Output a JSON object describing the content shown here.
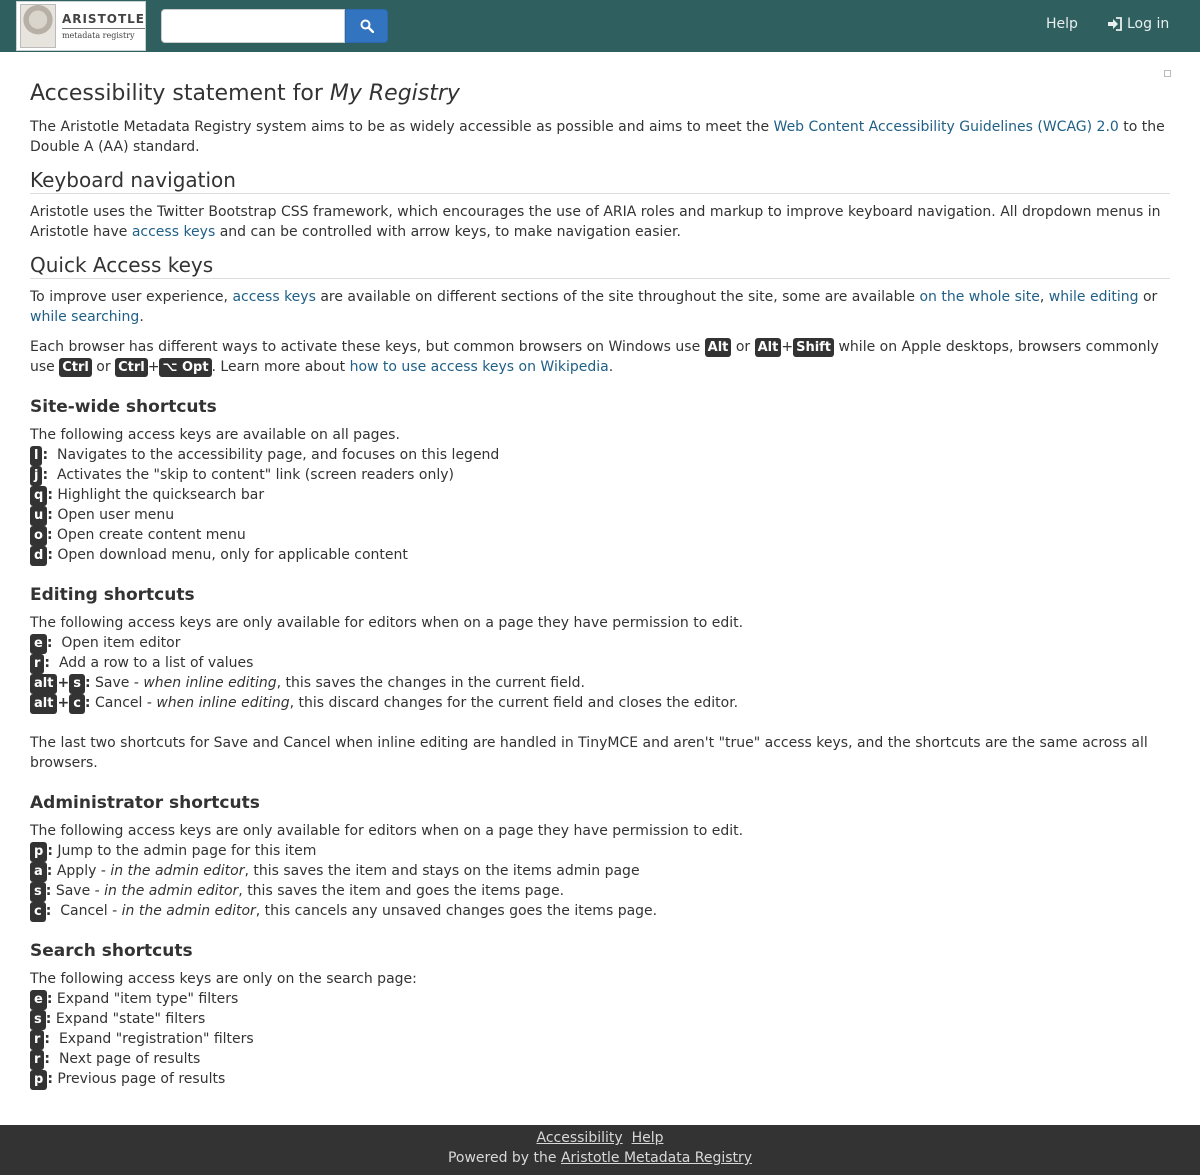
{
  "header": {
    "logo_title": "ARISTOTLE",
    "logo_subtitle": "metadata registry",
    "search_placeholder": "",
    "help_label": "Help",
    "login_label": "Log in",
    "brand_color": "#2f5f5e",
    "search_button_color": "#3374c0"
  },
  "page": {
    "title_prefix": "Accessibility statement for ",
    "title_registry": "My Registry",
    "intro_1": "The Aristotle Metadata Registry system aims to be as widely accessible as possible and aims to meet the ",
    "intro_link": "Web Content Accessibility Guidelines (WCAG) 2.0",
    "intro_2": " to the Double A (AA) standard."
  },
  "keyboard": {
    "heading": "Keyboard navigation",
    "text_1": "Aristotle uses the Twitter Bootstrap CSS framework, which encourages the use of ARIA roles and markup to improve keyboard navigation. All dropdown menus in Aristotle have ",
    "link": "access keys",
    "text_2": " and can be controlled with arrow keys, to make navigation easier."
  },
  "quick": {
    "heading": "Quick Access keys",
    "p1_a": "To improve user experience, ",
    "p1_link1": "access keys",
    "p1_b": " are available on different sections of the site throughout the site, some are available ",
    "p1_link2": "on the whole site",
    "p1_c": ", ",
    "p1_link3": "while editing",
    "p1_d": " or ",
    "p1_link4": "while searching",
    "p1_e": ".",
    "p2_a": "Each browser has different ways to activate these keys, but common browsers on Windows use ",
    "key_alt": "Alt",
    "or": " or ",
    "plus": "+",
    "key_shift": "Shift",
    "p2_b": " while on Apple desktops, browsers commonly use ",
    "key_ctrl": "Ctrl",
    "key_opt": "⌥ Opt",
    "p2_c": ". Learn more about ",
    "p2_link": "how to use access keys on Wikipedia",
    "p2_d": "."
  },
  "sitewide": {
    "heading": "Site-wide shortcuts",
    "intro": "The following access keys are available on all pages.",
    "items": [
      {
        "key": "l",
        "desc": "Navigates to the accessibility page, and focuses on this legend"
      },
      {
        "key": "j",
        "desc": "Activates the \"skip to content\" link (screen readers only)"
      },
      {
        "key": "q",
        "desc": "Highlight the quicksearch bar"
      },
      {
        "key": "u",
        "desc": "Open user menu"
      },
      {
        "key": "o",
        "desc": "Open create content menu"
      },
      {
        "key": "d",
        "desc": "Open download menu, only for applicable content"
      }
    ]
  },
  "editing": {
    "heading": "Editing shortcuts",
    "intro": "The following access keys are only available for editors when on a page they have permission to edit.",
    "items": [
      {
        "key": "e",
        "desc": "Open item editor"
      },
      {
        "key": "r",
        "desc": "Add a row to a list of values"
      }
    ],
    "combo_alt": "alt",
    "combo_plus": "+",
    "save": {
      "key": "s",
      "prefix": "Save - ",
      "em": "when inline editing",
      "suffix": ", this saves the changes in the current field."
    },
    "cancel": {
      "key": "c",
      "prefix": "Cancel - ",
      "em": "when inline editing",
      "suffix": ", this discard changes for the current field and closes the editor."
    },
    "note": "The last two shortcuts for Save and Cancel when inline editing are handled in TinyMCE and aren't \"true\" access keys, and the shortcuts are the same across all browsers."
  },
  "admin": {
    "heading": "Administrator shortcuts",
    "intro": "The following access keys are only available for editors when on a page they have permission to edit.",
    "p": {
      "key": "p",
      "desc": "Jump to the admin page for this item"
    },
    "a": {
      "key": "a",
      "prefix": "Apply - ",
      "em": "in the admin editor",
      "suffix": ", this saves the item and stays on the items admin page"
    },
    "s": {
      "key": "s",
      "prefix": "Save - ",
      "em": "in the admin editor",
      "suffix": ", this saves the item and goes the items page."
    },
    "c": {
      "key": "c",
      "prefix": "Cancel - ",
      "em": "in the admin editor",
      "suffix": ", this cancels any unsaved changes goes the items page."
    }
  },
  "search": {
    "heading": "Search shortcuts",
    "intro": "The following access keys are only on the search page:",
    "items": [
      {
        "key": "e",
        "desc": "Expand \"item type\" filters"
      },
      {
        "key": "s",
        "desc": "Expand \"state\" filters"
      },
      {
        "key": "r",
        "desc": "Expand \"registration\" filters"
      },
      {
        "key": "r",
        "desc": "Next page of results"
      },
      {
        "key": "p",
        "desc": "Previous page of results"
      }
    ]
  },
  "footer": {
    "accessibility": "Accessibility",
    "help": "Help",
    "powered_by": "Powered by the ",
    "powered_link": "Aristotle Metadata Registry"
  }
}
